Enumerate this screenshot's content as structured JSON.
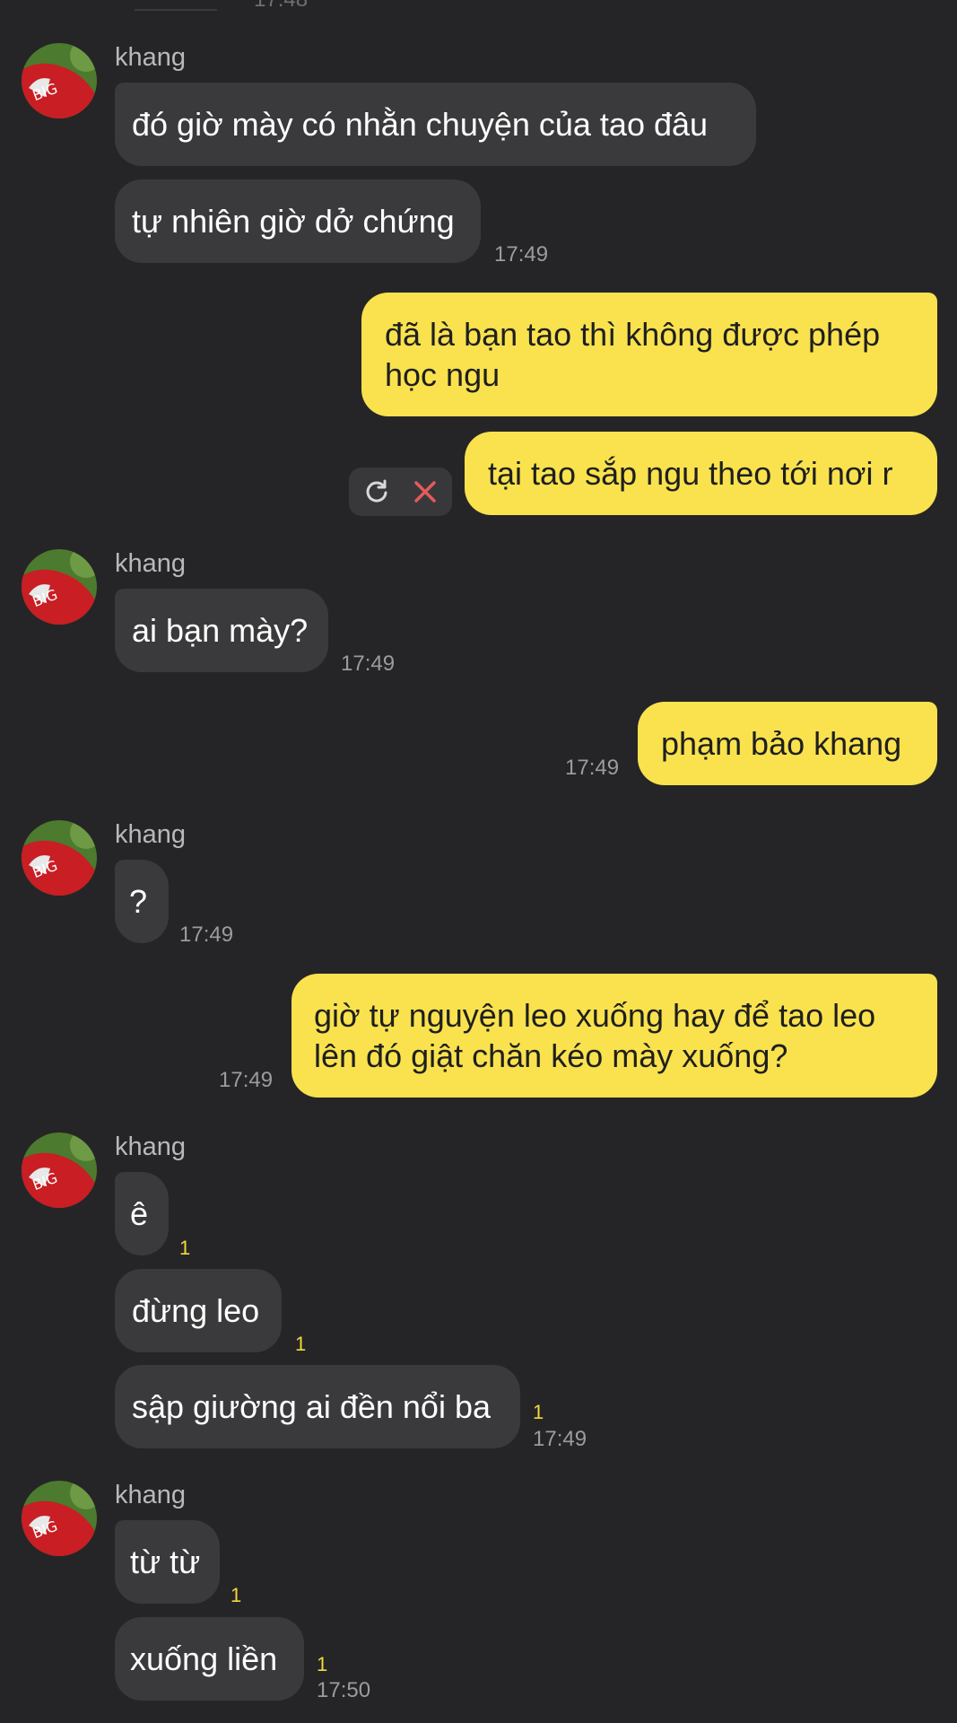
{
  "top": {
    "time": "17:48"
  },
  "sender_name": "khang",
  "messages": [
    {
      "text": "đó giờ mày có nhằn chuyện của tao đâu"
    },
    {
      "text": "tự nhiên giờ dở chứng",
      "time": "17:49"
    },
    {
      "text": "đã là bạn tao thì không được phép học ngu"
    },
    {
      "text": "tại tao sắp ngu theo tới nơi r"
    },
    {
      "text": "ai bạn mày?",
      "time": "17:49"
    },
    {
      "text": "phạm bảo khang",
      "time": "17:49"
    },
    {
      "text": "?",
      "time": "17:49"
    },
    {
      "text": "giờ tự nguyện leo xuống hay để tao leo lên đó giật chăn kéo mày xuống?",
      "time": "17:49"
    },
    {
      "text": "ê",
      "unread": "1"
    },
    {
      "text": "đừng leo",
      "unread": "1"
    },
    {
      "text": "sập giường ai đền nổi ba",
      "unread": "1",
      "time": "17:49"
    },
    {
      "text": "từ từ",
      "unread": "1"
    },
    {
      "text": "xuống liền",
      "unread": "1",
      "time": "17:50"
    }
  ],
  "colors": {
    "background": "#252527",
    "incoming_bubble": "#3a3a3c",
    "outgoing_bubble": "#f9e24e",
    "unread": "#f2d93c",
    "error_x": "#e25b5b"
  },
  "icons": {
    "retry": "refresh-icon",
    "cancel": "close-icon"
  }
}
